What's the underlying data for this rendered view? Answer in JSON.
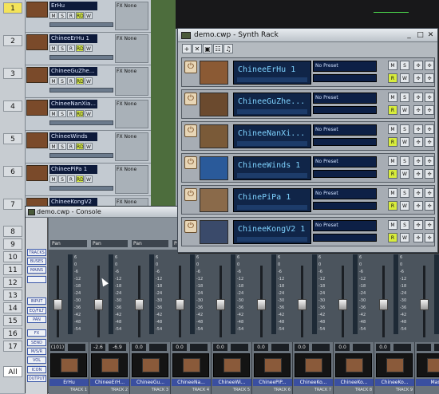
{
  "trackview": {
    "track_numbers": [
      "1",
      "2",
      "3",
      "4",
      "5",
      "6",
      "7",
      "8",
      "9",
      "10",
      "11",
      "12",
      "13",
      "14",
      "15",
      "16",
      "17"
    ],
    "tracks": [
      {
        "name": "ErHu",
        "value": "(C)",
        "fx_label": "FX",
        "fx_state": "None"
      },
      {
        "name": "ChineeErHu 1",
        "value": "-6.9",
        "fx_label": "FX",
        "fx_state": "None"
      },
      {
        "name": "ChineeGuZhe...",
        "value": "",
        "fx_label": "FX",
        "fx_state": "None"
      },
      {
        "name": "ChineeNanXia...",
        "value": "",
        "fx_label": "FX",
        "fx_state": "None"
      },
      {
        "name": "ChineeWinds",
        "value": "",
        "fx_label": "FX",
        "fx_state": "None"
      },
      {
        "name": "ChineePiPa 1",
        "value": "",
        "fx_label": "FX",
        "fx_state": "None"
      },
      {
        "name": "ChineeKongV2",
        "value": "",
        "fx_label": "FX",
        "fx_state": "None"
      }
    ],
    "all_tab": "All",
    "mini_buttons": [
      "M",
      "S",
      "R",
      "RD",
      "W"
    ]
  },
  "synthrack": {
    "title": "demo.cwp - Synth Rack",
    "window_controls": [
      "_",
      "□",
      "✕"
    ],
    "toolbar_icons": [
      "+",
      "✕",
      "▣",
      "☷",
      "♫"
    ],
    "instruments": [
      {
        "name": "ChineeErHu 1",
        "preset": "No Preset"
      },
      {
        "name": "ChineeGuZhe...",
        "preset": "No Preset"
      },
      {
        "name": "ChineeNanXi...",
        "preset": "No Preset"
      },
      {
        "name": "ChineeWinds 1",
        "preset": "No Preset"
      },
      {
        "name": "ChinePiPa 1",
        "preset": "No Preset"
      },
      {
        "name": "ChineeKongV2 1",
        "preset": "No Preset"
      }
    ],
    "side_buttons": [
      "M",
      "S",
      "R",
      "W"
    ]
  },
  "console": {
    "title": "demo.cwp - Console",
    "left_buttons": [
      "TRACKS",
      "BUSES",
      "MAINS",
      "",
      "INPUT",
      "EQ/FILT",
      "PAN",
      "FX",
      "SEND",
      "M/S/R",
      "VOL",
      "ICON",
      "OUTPUT"
    ],
    "channels": [
      {
        "name": "ErHu",
        "label": "TRACK 1",
        "pan": "Pan",
        "vol": "(101)",
        "vol2": ""
      },
      {
        "name": "ChineeErH...",
        "label": "TRACK 2",
        "pan": "Pan",
        "vol": "-2.6",
        "vol2": "-6.9"
      },
      {
        "name": "ChineeGu...",
        "label": "TRACK 3",
        "pan": "Pan",
        "vol": "0.0",
        "vol2": ""
      },
      {
        "name": "ChineeNa...",
        "label": "TRACK 4",
        "pan": "Pan",
        "vol": "0.0",
        "vol2": ""
      },
      {
        "name": "ChineeWi...",
        "label": "TRACK 5",
        "pan": "Pan",
        "vol": "0.0",
        "vol2": ""
      },
      {
        "name": "ChineePiP...",
        "label": "TRACK 6",
        "pan": "Pan",
        "vol": "0.0",
        "vol2": ""
      },
      {
        "name": "ChineeKo...",
        "label": "TRACK 7",
        "pan": "Pan",
        "vol": "0.0",
        "vol2": ""
      },
      {
        "name": "ChineeKo...",
        "label": "TRACK 8",
        "pan": "Pan",
        "vol": "0.0",
        "vol2": ""
      },
      {
        "name": "ChineeKo...",
        "label": "TRACK 9",
        "pan": "Pan",
        "vol": "0.0",
        "vol2": ""
      },
      {
        "name": "Mas",
        "label": "",
        "pan": "",
        "vol": "",
        "vol2": ""
      }
    ],
    "scale": [
      "6",
      "0",
      "-6",
      "-12",
      "-18",
      "-24",
      "-30",
      "-36",
      "-42",
      "-48",
      "-54"
    ]
  }
}
